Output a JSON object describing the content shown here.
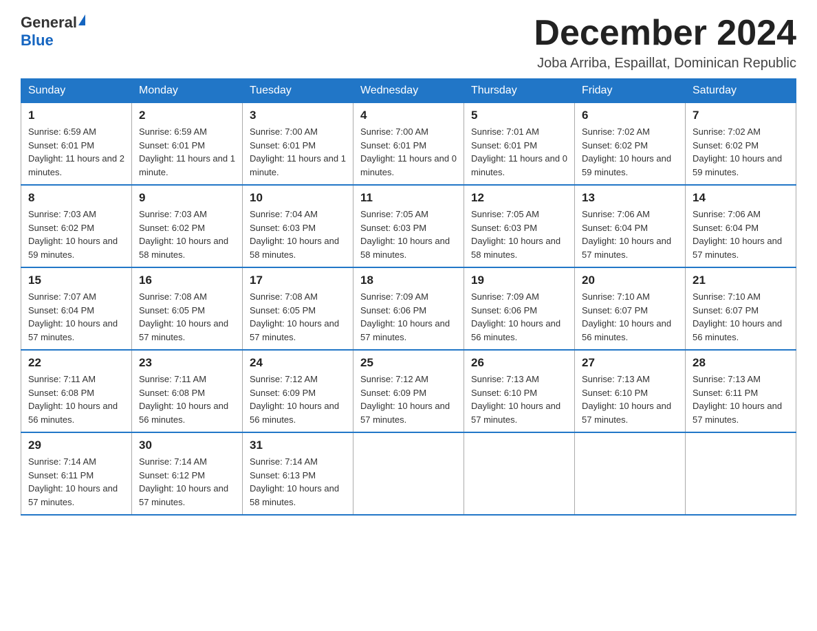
{
  "header": {
    "logo_general": "General",
    "logo_blue": "Blue",
    "month_title": "December 2024",
    "location": "Joba Arriba, Espaillat, Dominican Republic"
  },
  "days_of_week": [
    "Sunday",
    "Monday",
    "Tuesday",
    "Wednesday",
    "Thursday",
    "Friday",
    "Saturday"
  ],
  "weeks": [
    [
      {
        "day": "1",
        "sunrise": "6:59 AM",
        "sunset": "6:01 PM",
        "daylight": "11 hours and 2 minutes."
      },
      {
        "day": "2",
        "sunrise": "6:59 AM",
        "sunset": "6:01 PM",
        "daylight": "11 hours and 1 minute."
      },
      {
        "day": "3",
        "sunrise": "7:00 AM",
        "sunset": "6:01 PM",
        "daylight": "11 hours and 1 minute."
      },
      {
        "day": "4",
        "sunrise": "7:00 AM",
        "sunset": "6:01 PM",
        "daylight": "11 hours and 0 minutes."
      },
      {
        "day": "5",
        "sunrise": "7:01 AM",
        "sunset": "6:01 PM",
        "daylight": "11 hours and 0 minutes."
      },
      {
        "day": "6",
        "sunrise": "7:02 AM",
        "sunset": "6:02 PM",
        "daylight": "10 hours and 59 minutes."
      },
      {
        "day": "7",
        "sunrise": "7:02 AM",
        "sunset": "6:02 PM",
        "daylight": "10 hours and 59 minutes."
      }
    ],
    [
      {
        "day": "8",
        "sunrise": "7:03 AM",
        "sunset": "6:02 PM",
        "daylight": "10 hours and 59 minutes."
      },
      {
        "day": "9",
        "sunrise": "7:03 AM",
        "sunset": "6:02 PM",
        "daylight": "10 hours and 58 minutes."
      },
      {
        "day": "10",
        "sunrise": "7:04 AM",
        "sunset": "6:03 PM",
        "daylight": "10 hours and 58 minutes."
      },
      {
        "day": "11",
        "sunrise": "7:05 AM",
        "sunset": "6:03 PM",
        "daylight": "10 hours and 58 minutes."
      },
      {
        "day": "12",
        "sunrise": "7:05 AM",
        "sunset": "6:03 PM",
        "daylight": "10 hours and 58 minutes."
      },
      {
        "day": "13",
        "sunrise": "7:06 AM",
        "sunset": "6:04 PM",
        "daylight": "10 hours and 57 minutes."
      },
      {
        "day": "14",
        "sunrise": "7:06 AM",
        "sunset": "6:04 PM",
        "daylight": "10 hours and 57 minutes."
      }
    ],
    [
      {
        "day": "15",
        "sunrise": "7:07 AM",
        "sunset": "6:04 PM",
        "daylight": "10 hours and 57 minutes."
      },
      {
        "day": "16",
        "sunrise": "7:08 AM",
        "sunset": "6:05 PM",
        "daylight": "10 hours and 57 minutes."
      },
      {
        "day": "17",
        "sunrise": "7:08 AM",
        "sunset": "6:05 PM",
        "daylight": "10 hours and 57 minutes."
      },
      {
        "day": "18",
        "sunrise": "7:09 AM",
        "sunset": "6:06 PM",
        "daylight": "10 hours and 57 minutes."
      },
      {
        "day": "19",
        "sunrise": "7:09 AM",
        "sunset": "6:06 PM",
        "daylight": "10 hours and 56 minutes."
      },
      {
        "day": "20",
        "sunrise": "7:10 AM",
        "sunset": "6:07 PM",
        "daylight": "10 hours and 56 minutes."
      },
      {
        "day": "21",
        "sunrise": "7:10 AM",
        "sunset": "6:07 PM",
        "daylight": "10 hours and 56 minutes."
      }
    ],
    [
      {
        "day": "22",
        "sunrise": "7:11 AM",
        "sunset": "6:08 PM",
        "daylight": "10 hours and 56 minutes."
      },
      {
        "day": "23",
        "sunrise": "7:11 AM",
        "sunset": "6:08 PM",
        "daylight": "10 hours and 56 minutes."
      },
      {
        "day": "24",
        "sunrise": "7:12 AM",
        "sunset": "6:09 PM",
        "daylight": "10 hours and 56 minutes."
      },
      {
        "day": "25",
        "sunrise": "7:12 AM",
        "sunset": "6:09 PM",
        "daylight": "10 hours and 57 minutes."
      },
      {
        "day": "26",
        "sunrise": "7:13 AM",
        "sunset": "6:10 PM",
        "daylight": "10 hours and 57 minutes."
      },
      {
        "day": "27",
        "sunrise": "7:13 AM",
        "sunset": "6:10 PM",
        "daylight": "10 hours and 57 minutes."
      },
      {
        "day": "28",
        "sunrise": "7:13 AM",
        "sunset": "6:11 PM",
        "daylight": "10 hours and 57 minutes."
      }
    ],
    [
      {
        "day": "29",
        "sunrise": "7:14 AM",
        "sunset": "6:11 PM",
        "daylight": "10 hours and 57 minutes."
      },
      {
        "day": "30",
        "sunrise": "7:14 AM",
        "sunset": "6:12 PM",
        "daylight": "10 hours and 57 minutes."
      },
      {
        "day": "31",
        "sunrise": "7:14 AM",
        "sunset": "6:13 PM",
        "daylight": "10 hours and 58 minutes."
      },
      null,
      null,
      null,
      null
    ]
  ],
  "labels": {
    "sunrise": "Sunrise:",
    "sunset": "Sunset:",
    "daylight": "Daylight:"
  }
}
